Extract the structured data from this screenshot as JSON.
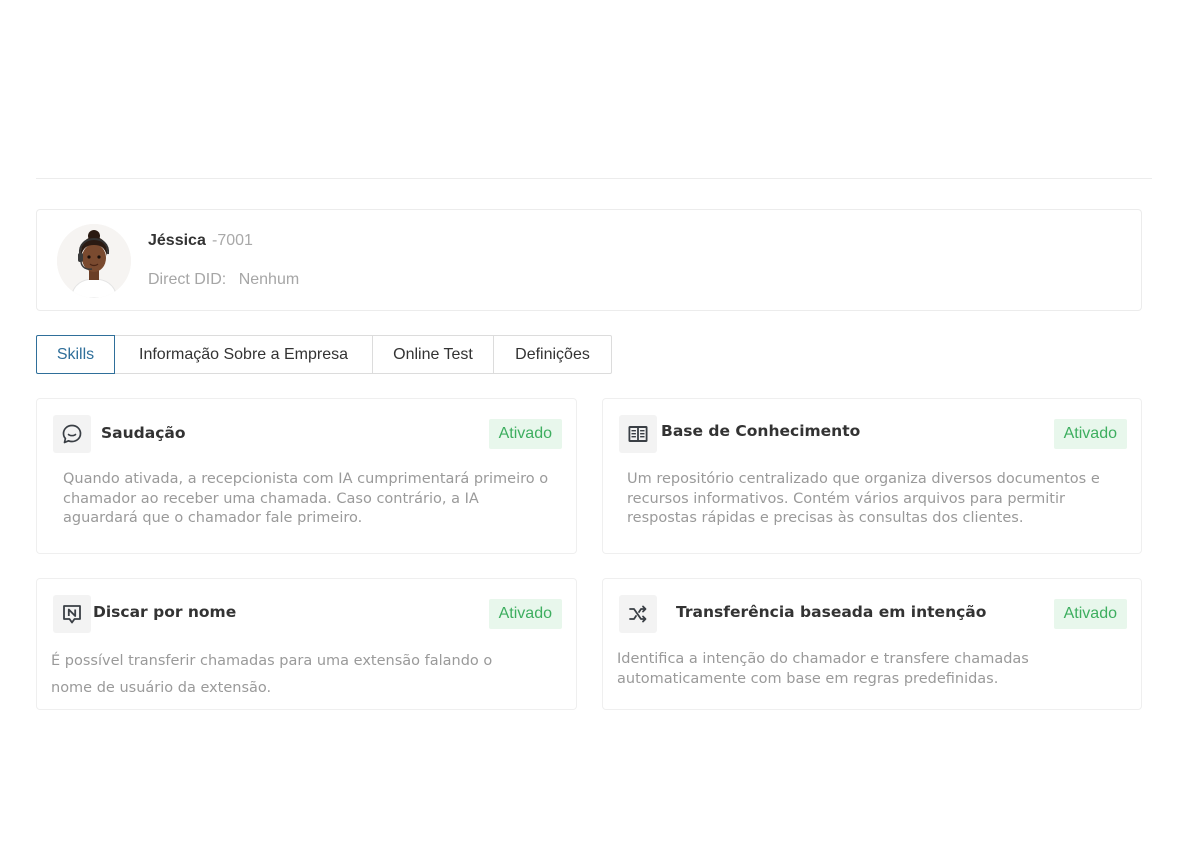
{
  "agent": {
    "name": "Jéssica",
    "extension": "-7001",
    "did_label": "Direct DID:",
    "did_value": "Nenhum"
  },
  "tabs": [
    {
      "label": "Skills",
      "active": true
    },
    {
      "label": "Informação Sobre a Empresa",
      "active": false
    },
    {
      "label": "Online Test",
      "active": false
    },
    {
      "label": "Definições",
      "active": false
    }
  ],
  "skills": [
    {
      "icon": "chat-bubble-icon",
      "title": "Saudação",
      "status": "Ativado",
      "description": "Quando ativada, a recepcionista com IA cumprimentará primeiro o chamador ao receber uma chamada. Caso contrário, a IA aguardará que o chamador fale primeiro."
    },
    {
      "icon": "book-icon",
      "title": "Base de Conhecimento",
      "status": "Ativado",
      "description": "Um repositório centralizado que organiza diversos documentos e recursos informativos. Contém vários arquivos para permitir respostas rápidas e precisas às consultas dos clientes."
    },
    {
      "icon": "name-dial-icon",
      "title": "Discar por nome",
      "status": "Ativado",
      "description": "É possível transferir chamadas para uma extensão falando o nome de usuário da extensão."
    },
    {
      "icon": "shuffle-icon",
      "title": "Transferência baseada em intenção",
      "status": "Ativado",
      "description": "Identifica a intenção do chamador e transfere chamadas automaticamente com base em regras predefinidas."
    }
  ],
  "colors": {
    "accent": "#2f6f9a",
    "status_bg": "#e8f7ec",
    "status_text": "#3dae5f"
  }
}
